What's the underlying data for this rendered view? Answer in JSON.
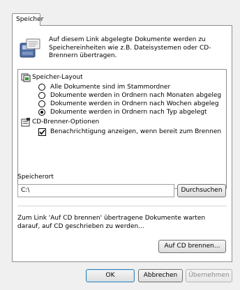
{
  "tab": {
    "label": "Speicher"
  },
  "intro": {
    "icon": "storage-icon",
    "text": "Auf diesem Link abgelegte Dokumente werden zu Speichereinheiten wie z.B. Dateisystemen oder CD-Brennern übertragen."
  },
  "layout_group": {
    "icon": "layout-icon",
    "label": "Speicher-Layout",
    "options": [
      {
        "label": "Alle Dokumente sind im Stammordner",
        "selected": false
      },
      {
        "label": "Dokumente werden in Ordnern nach Monaten abgeleg",
        "selected": false
      },
      {
        "label": "Dokumente werden in Ordnern nach Wochen abgeleg",
        "selected": false
      },
      {
        "label": "Dokumente werden in Ordnern nach Typ abgelegt",
        "selected": true
      }
    ]
  },
  "cd_group": {
    "icon": "cd-burner-icon",
    "label": "CD-Brenner-Optionen",
    "notify_label": "Benachrichtigung anzeigen, wenn bereit zum Brennen",
    "notify_checked": true
  },
  "location": {
    "label": "Speicherort",
    "value": "C:\\",
    "browse_label": "Durchsuchen"
  },
  "cd_note": {
    "text": "Zum Link 'Auf CD brennen' übertragene Dokumente warten darauf, auf CD geschrieben zu werden...",
    "burn_label": "Auf CD brennen..."
  },
  "footer": {
    "ok_label": "OK",
    "cancel_label": "Abbrechen",
    "apply_label": "Übernehmen"
  }
}
